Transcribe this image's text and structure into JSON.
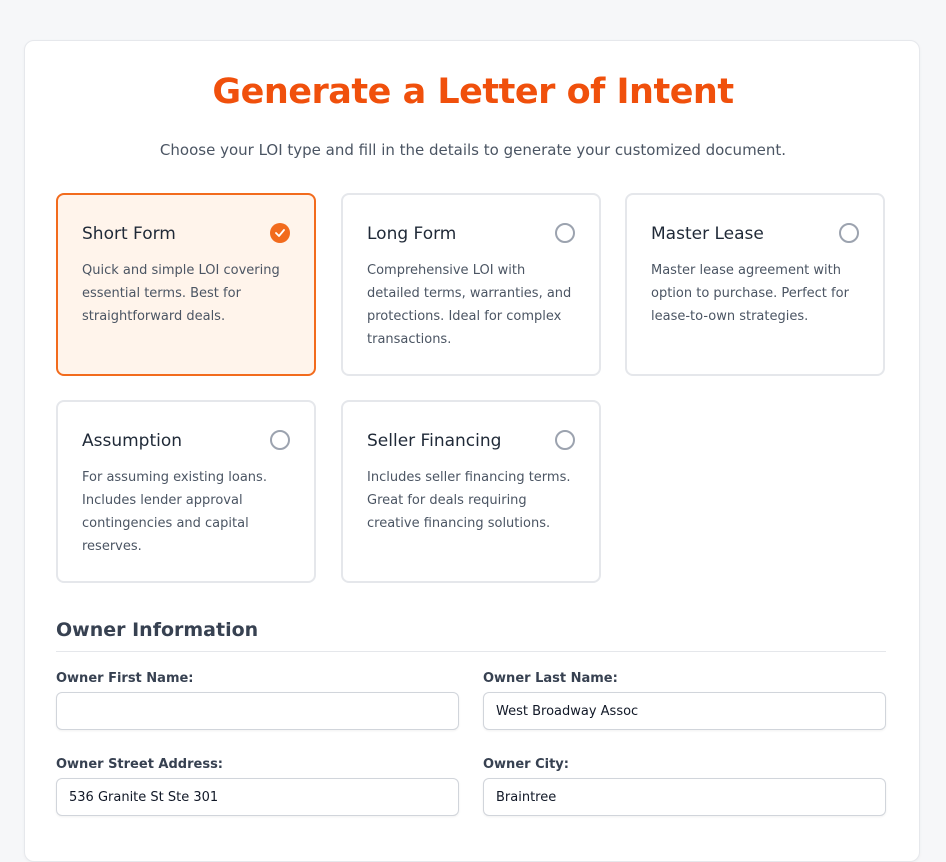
{
  "header": {
    "title": "Generate a Letter of Intent",
    "subtitle": "Choose your LOI type and fill in the details to generate your customized document."
  },
  "loi_types": [
    {
      "title": "Short Form",
      "description": "Quick and simple LOI covering essential terms. Best for straightforward deals.",
      "selected": true
    },
    {
      "title": "Long Form",
      "description": "Comprehensive LOI with detailed terms, warranties, and protections. Ideal for complex transactions.",
      "selected": false
    },
    {
      "title": "Master Lease",
      "description": "Master lease agreement with option to purchase. Perfect for lease-to-own strategies.",
      "selected": false
    },
    {
      "title": "Assumption",
      "description": "For assuming existing loans. Includes lender approval contingencies and capital reserves.",
      "selected": false
    },
    {
      "title": "Seller Financing",
      "description": "Includes seller financing terms. Great for deals requiring creative financing solutions.",
      "selected": false
    }
  ],
  "owner_section": {
    "title": "Owner Information",
    "fields": {
      "first_name": {
        "label": "Owner First Name:",
        "value": ""
      },
      "last_name": {
        "label": "Owner Last Name:",
        "value": "West Broadway Assoc"
      },
      "street": {
        "label": "Owner Street Address:",
        "value": "536 Granite St Ste 301"
      },
      "city": {
        "label": "Owner City:",
        "value": "Braintree"
      }
    }
  },
  "colors": {
    "accent": "#f0500c",
    "selected_border": "#f26b1d",
    "selected_bg": "#fff4eb"
  }
}
